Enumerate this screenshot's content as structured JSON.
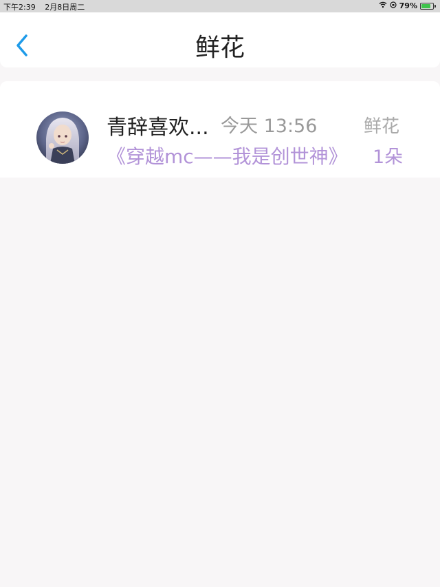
{
  "status_bar": {
    "time": "下午2:39",
    "date": "2月8日周二",
    "battery_percent": "79%",
    "battery_level": 0.79,
    "wifi_icon": "wifi-icon",
    "rotation_lock_icon": "rotation-lock-icon",
    "battery_icon": "battery-charging-icon",
    "battery_color": "#3ec34b"
  },
  "header": {
    "title": "鲜花",
    "back_icon": "chevron-left-icon",
    "accent_color": "#1e9be9"
  },
  "list": {
    "items": [
      {
        "name": "青辞喜欢...",
        "time": "今天 13:56",
        "type": "鲜花",
        "book": "《穿越mc——我是创世神》",
        "count": "1朵",
        "accent_color": "#b293d8"
      }
    ]
  }
}
